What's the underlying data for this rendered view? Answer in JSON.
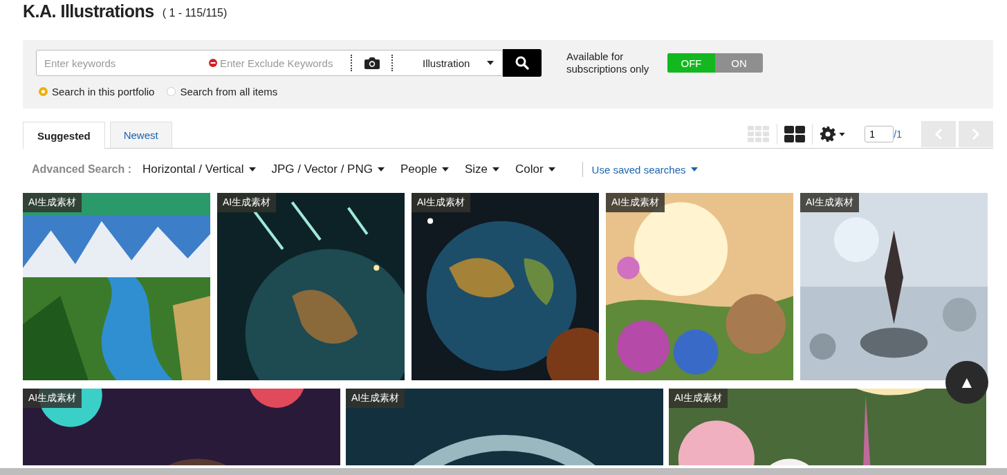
{
  "header": {
    "title": "K.A. Illustrations",
    "range": "( 1 - 115/115)"
  },
  "search": {
    "keywords_placeholder": "Enter keywords",
    "exclude_placeholder": "Enter Exclude Keywords",
    "category": "Illustration",
    "scope": [
      {
        "label": "Search in this portfolio",
        "selected": true
      },
      {
        "label": "Search from all items",
        "selected": false
      }
    ],
    "subscription_label": "Available for subscriptions only",
    "toggle": {
      "off_label": "OFF",
      "on_label": "ON",
      "on": false
    }
  },
  "tabs": [
    {
      "label": "Suggested",
      "selected": true
    },
    {
      "label": "Newest",
      "selected": false
    }
  ],
  "view": {
    "layouts": [
      {
        "kind": "small",
        "selected": false
      },
      {
        "kind": "large",
        "selected": true
      }
    ],
    "page": "1",
    "total": "/1",
    "prev_disabled": true,
    "next_disabled": true
  },
  "filters": {
    "label": "Advanced Search :",
    "items": [
      "Horizontal / Vertical",
      "JPG / Vector / PNG",
      "People",
      "Size",
      "Color"
    ],
    "saved": "Use saved searches"
  },
  "rows": [
    [
      {
        "badge": "AI生成素材"
      },
      {
        "badge": "AI生成素材"
      },
      {
        "badge": "AI生成素材"
      },
      {
        "badge": "AI生成素材"
      },
      {
        "badge": "AI生成素材"
      }
    ],
    [
      {
        "badge": "AI生成素材"
      },
      {
        "badge": "AI生成素材"
      },
      {
        "badge": "AI生成素材"
      }
    ]
  ],
  "back_to_top": "▲"
}
